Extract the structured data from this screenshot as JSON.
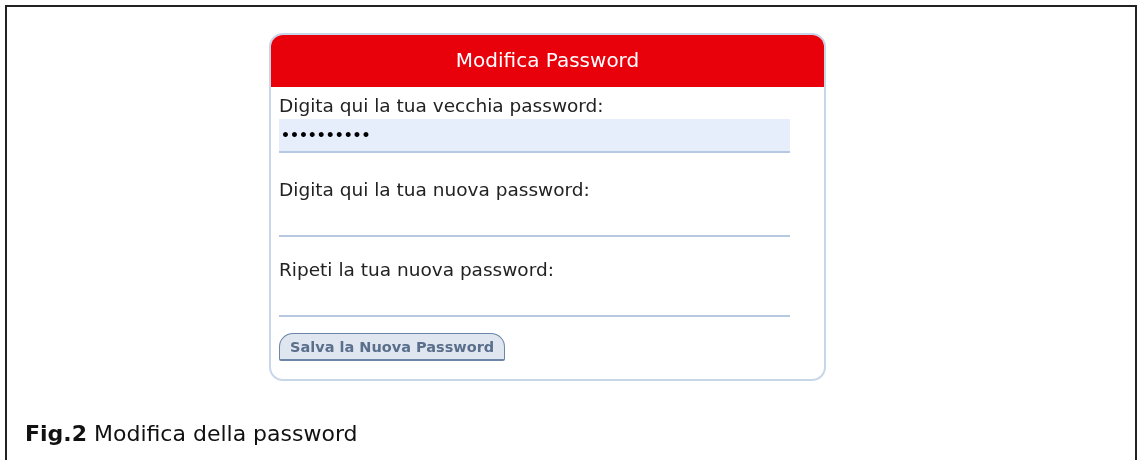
{
  "panel": {
    "title": "Modifica Password",
    "fields": [
      {
        "label": "Digita qui la tua vecchia password:",
        "value": "••••••••••",
        "focused": true
      },
      {
        "label": "Digita qui la tua nuova password:",
        "focused": false
      },
      {
        "label": "Ripeti la tua nuova password:",
        "focused": false
      }
    ],
    "button": "Salva la Nuova Password"
  },
  "caption": "**Fig.2** Modifica della password"
}
